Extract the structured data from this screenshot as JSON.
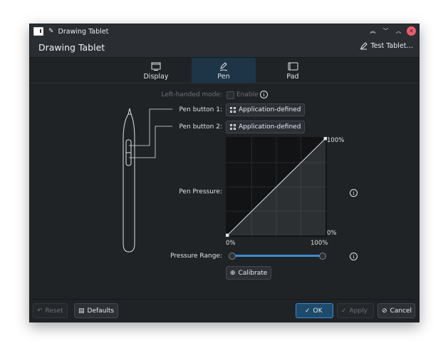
{
  "window": {
    "title": "Drawing Tablet"
  },
  "header": {
    "title": "Drawing Tablet",
    "test_button": "Test Tablet…"
  },
  "tabs": [
    {
      "label": "Display",
      "icon": "display-icon"
    },
    {
      "label": "Pen",
      "icon": "pen-icon"
    },
    {
      "label": "Pad",
      "icon": "pad-icon"
    }
  ],
  "active_tab": "Pen",
  "settings": {
    "left_handed_label": "Left-handed mode:",
    "left_handed_checkbox": "Enable",
    "pen_button1_label": "Pen button 1:",
    "pen_button1_value": "Application-defined",
    "pen_button2_label": "Pen button 2:",
    "pen_button2_value": "Application-defined",
    "pressure_label": "Pen Pressure:",
    "pressure_range_label": "Pressure Range:",
    "calibrate_button": "Calibrate"
  },
  "chart_data": {
    "type": "line",
    "x": [
      0,
      100
    ],
    "y": [
      0,
      100
    ],
    "xlim": [
      0,
      100
    ],
    "ylim": [
      0,
      100
    ],
    "x_ticks": [
      "0%",
      "100%"
    ],
    "y_ticks": [
      "0%",
      "100%"
    ],
    "grid": true
  },
  "pressure_range": {
    "min": 0,
    "max": 100
  },
  "footer": {
    "reset": "Reset",
    "defaults": "Defaults",
    "ok": "OK",
    "apply": "Apply",
    "cancel": "Cancel"
  },
  "colors": {
    "accent": "#3d8ad0",
    "background": "#202326",
    "active_tab": "#1e3447",
    "close": "#ed5b6d"
  }
}
